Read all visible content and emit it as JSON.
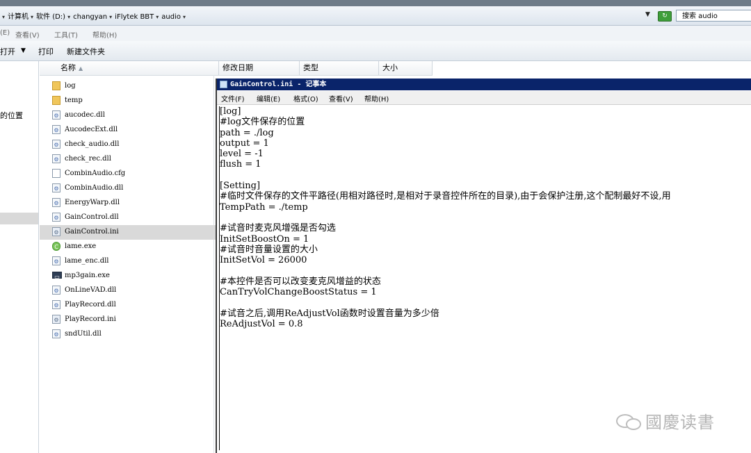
{
  "explorer": {
    "breadcrumb": [
      "计算机",
      "软件 (D:)",
      "changyan",
      "iFlytek BBT",
      "audio"
    ],
    "search_placeholder": "搜索 audio",
    "menu": [
      "(E)",
      "查看(V)",
      "工具(T)",
      "帮助(H)"
    ],
    "toolbar": {
      "open": "打开",
      "print": "打印",
      "new_folder": "新建文件夹"
    },
    "nav_text": "的位置",
    "columns": {
      "name": "名称",
      "modified": "修改日期",
      "type": "类型",
      "size": "大小"
    },
    "files": [
      {
        "name": "log",
        "icon": "folder-icon"
      },
      {
        "name": "temp",
        "icon": "folder-icon"
      },
      {
        "name": "aucodec.dll",
        "icon": "dll-icon"
      },
      {
        "name": "AucodecExt.dll",
        "icon": "dll-icon"
      },
      {
        "name": "check_audio.dll",
        "icon": "dll-icon"
      },
      {
        "name": "check_rec.dll",
        "icon": "dll-icon"
      },
      {
        "name": "CombinAudio.cfg",
        "icon": "cfg-file-icon"
      },
      {
        "name": "CombinAudio.dll",
        "icon": "dll-icon"
      },
      {
        "name": "EnergyWarp.dll",
        "icon": "dll-icon"
      },
      {
        "name": "GainControl.dll",
        "icon": "dll-icon"
      },
      {
        "name": "GainControl.ini",
        "icon": "ini-file-icon",
        "selected": true
      },
      {
        "name": "lame.exe",
        "icon": "exe-icon"
      },
      {
        "name": "lame_enc.dll",
        "icon": "dll-icon"
      },
      {
        "name": "mp3gain.exe",
        "icon": "console-exe-icon"
      },
      {
        "name": "OnLineVAD.dll",
        "icon": "dll-icon"
      },
      {
        "name": "PlayRecord.dll",
        "icon": "dll-icon"
      },
      {
        "name": "PlayRecord.ini",
        "icon": "ini-file-icon"
      },
      {
        "name": "sndUtil.dll",
        "icon": "dll-icon"
      }
    ]
  },
  "notepad": {
    "title": "GainControl.ini - 记事本",
    "menu": [
      "文件(F)",
      "编辑(E)",
      "格式(O)",
      "查看(V)",
      "帮助(H)"
    ],
    "content": "[log]\n#log文件保存的位置\npath = ./log\noutput = 1\nlevel = -1\nflush = 1\n\n[Setting]\n#临时文件保存的文件平路径(用相对路径时,是相对于录音控件所在的目录),由于会保护注册,这个配制最好不设,用\nTempPath = ./temp\n\n#试音时麦克风增强是否勾选\nInitSetBoostOn = 1\n#试音时音量设置的大小\nInitSetVol = 26000\n\n#本控件是否可以改变麦克风增益的状态\nCanTryVolChangeBoostStatus = 1\n\n#试音之后,调用ReAdjustVol函数时设置音量为多少倍\nReAdjustVol = 0.8"
  },
  "watermark": {
    "text": "國慶读書"
  }
}
